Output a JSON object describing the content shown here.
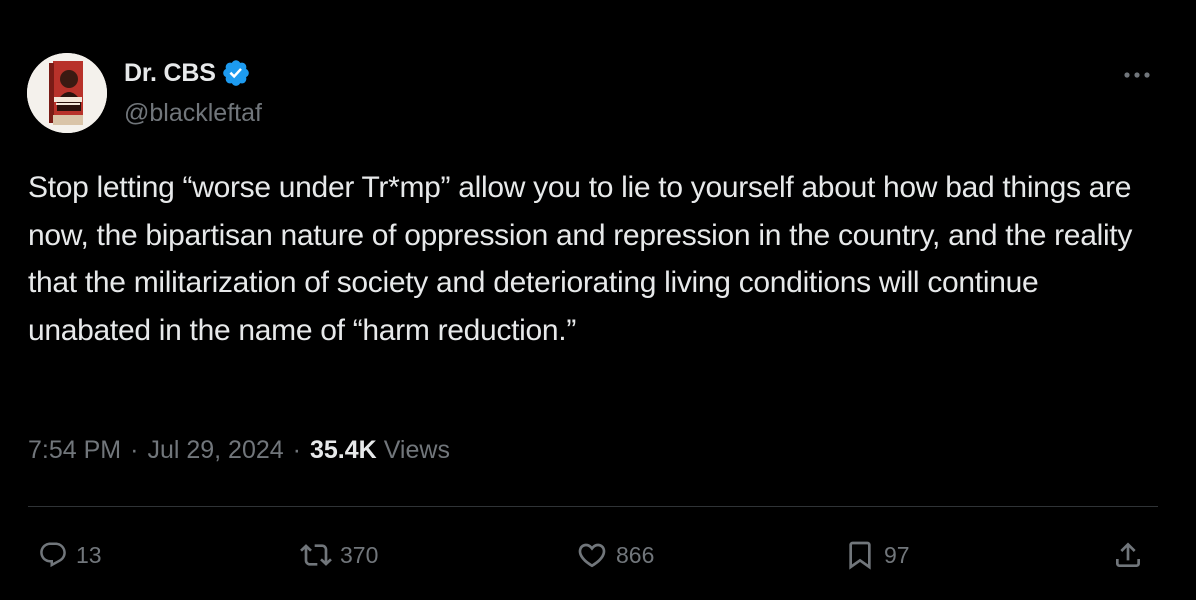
{
  "author": {
    "display_name": "Dr. CBS",
    "handle": "@blackleftaf",
    "verified_icon": "verified-badge-icon",
    "avatar_icon": "book-cover-avatar"
  },
  "tweet": {
    "text": "Stop letting “worse under Tr*mp” allow you to lie to yourself about how bad things are now, the bipartisan nature of oppression and repression in the country, and the reality that the militarization of society and deteriorating living conditions will continue unabated in the name of “harm reduction.”",
    "time": "7:54 PM",
    "date": "Jul 29, 2024",
    "separator": "·",
    "views_count": "35.4K",
    "views_label": "Views"
  },
  "actions": {
    "replies": "13",
    "reposts": "370",
    "likes": "866",
    "bookmarks": "97"
  },
  "colors": {
    "background": "#000000",
    "primary_text": "#e7e9ea",
    "secondary_text": "#71767b",
    "verified": "#1d9bf0",
    "divider": "#2f3336"
  }
}
